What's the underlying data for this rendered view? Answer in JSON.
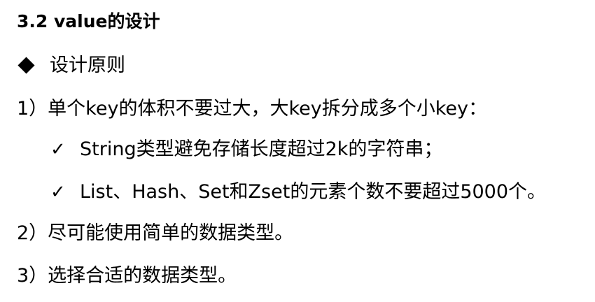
{
  "heading": "3.2 value的设计",
  "principle": {
    "icon": "diamond-bullet-icon",
    "label": "设计原则"
  },
  "items": [
    {
      "text": "1）单个key的体积不要过大，大key拆分成多个小key："
    },
    {
      "text": "2）尽可能使用简单的数据类型。"
    },
    {
      "text": "3）选择合适的数据类型。"
    }
  ],
  "checks": {
    "mark": "✓",
    "list": [
      "String类型避免存储长度超过2k的字符串；",
      "List、Hash、Set和Zset的元素个数不要超过5000个。"
    ]
  }
}
